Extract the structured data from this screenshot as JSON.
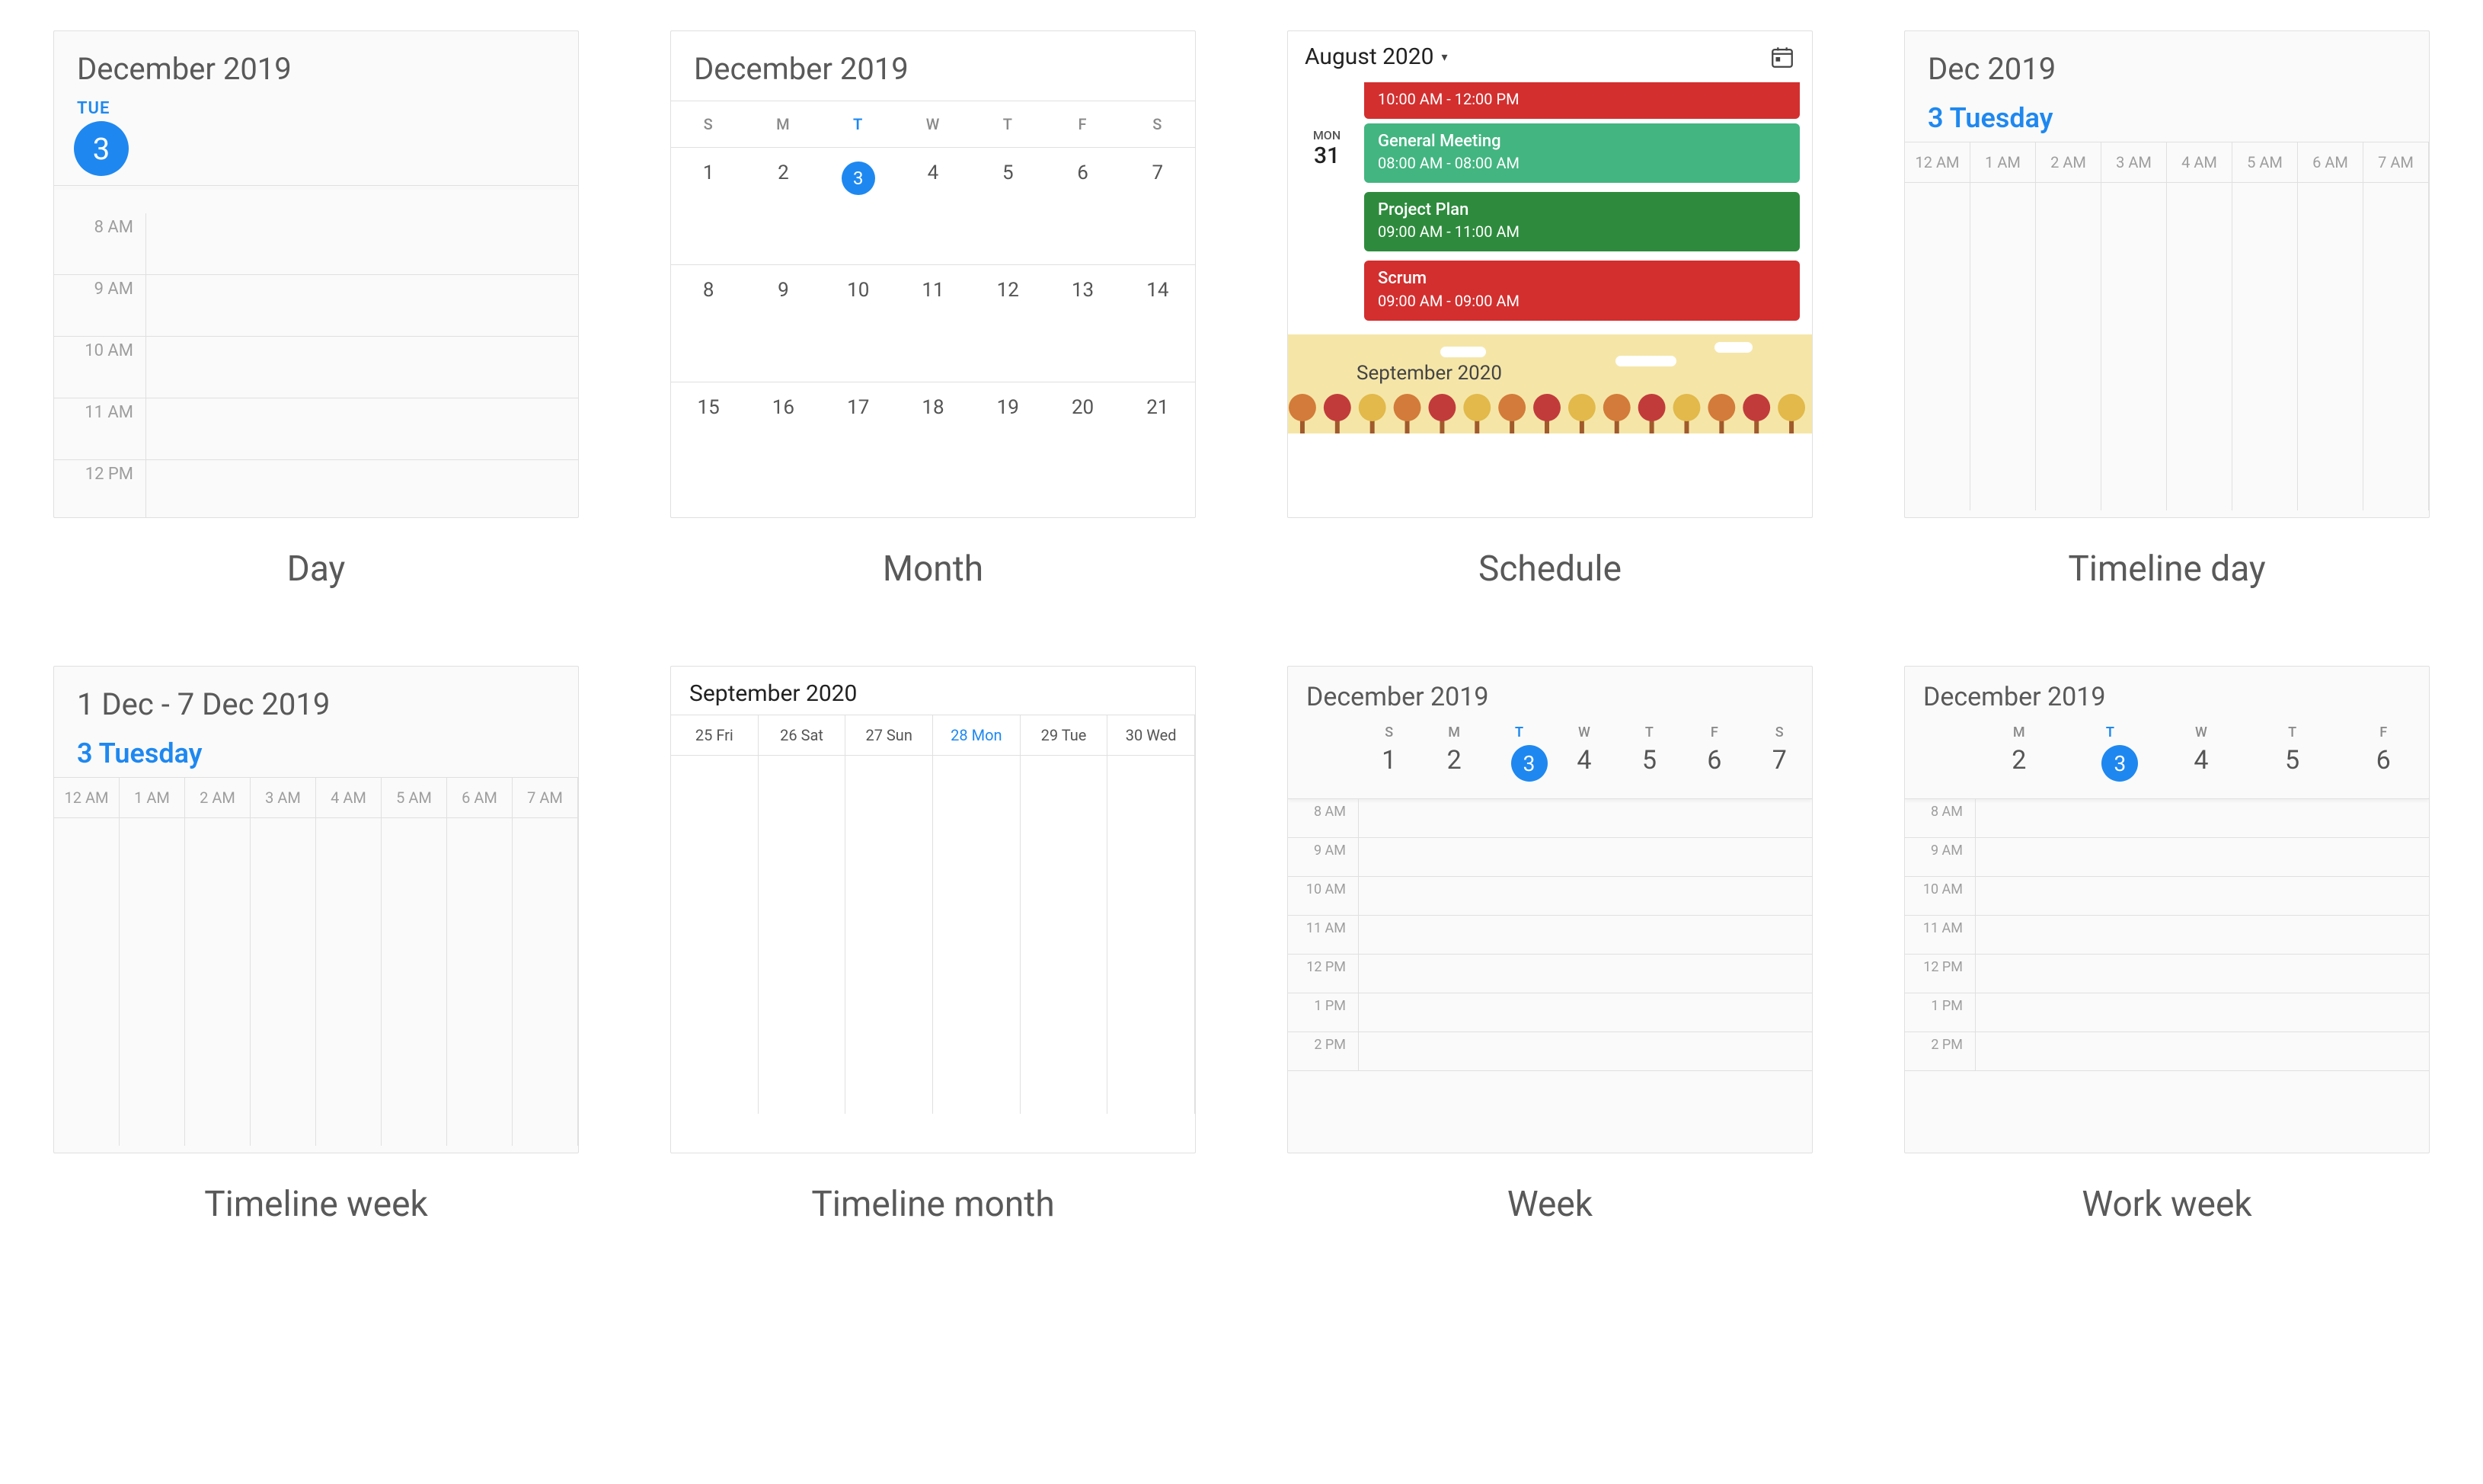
{
  "captions": {
    "day": "Day",
    "month": "Month",
    "schedule": "Schedule",
    "timeline_day": "Timeline day",
    "timeline_week": "Timeline week",
    "timeline_month": "Timeline month",
    "week": "Week",
    "work_week": "Work week"
  },
  "day_view": {
    "title": "December 2019",
    "dow": "TUE",
    "date": "3",
    "hours": [
      "8 AM",
      "9 AM",
      "10 AM",
      "11 AM",
      "12 PM"
    ]
  },
  "month_view": {
    "title": "December 2019",
    "dow": [
      "S",
      "M",
      "T",
      "W",
      "T",
      "F",
      "S"
    ],
    "today_index": 2,
    "weeks": [
      [
        "1",
        "2",
        "3",
        "4",
        "5",
        "6",
        "7"
      ],
      [
        "8",
        "9",
        "10",
        "11",
        "12",
        "13",
        "14"
      ],
      [
        "15",
        "16",
        "17",
        "18",
        "19",
        "20",
        "21"
      ]
    ],
    "today": "3"
  },
  "schedule_view": {
    "title": "August 2020",
    "top_event_time": "10:00 AM - 12:00 PM",
    "day": {
      "dow": "MON",
      "num": "31"
    },
    "events": [
      {
        "title": "General Meeting",
        "time": "08:00 AM - 08:00 AM",
        "color": "g1"
      },
      {
        "title": "Project Plan",
        "time": "09:00 AM - 11:00 AM",
        "color": "g2"
      },
      {
        "title": "Scrum",
        "time": "09:00 AM - 09:00 AM",
        "color": "red"
      }
    ],
    "next_month": "September 2020"
  },
  "timeline_day": {
    "title": "Dec 2019",
    "subtitle": "3 Tuesday",
    "hours": [
      "12 AM",
      "1 AM",
      "2 AM",
      "3 AM",
      "4 AM",
      "5 AM",
      "6 AM",
      "7 AM"
    ]
  },
  "timeline_week": {
    "title": "1 Dec - 7 Dec 2019",
    "subtitle": "3 Tuesday",
    "hours": [
      "12 AM",
      "1 AM",
      "2 AM",
      "3 AM",
      "4 AM",
      "5 AM",
      "6 AM",
      "7 AM"
    ]
  },
  "timeline_month": {
    "title": "September 2020",
    "days": [
      "25 Fri",
      "26 Sat",
      "27 Sun",
      "28 Mon",
      "29 Tue",
      "30 Wed"
    ],
    "today_index": 3
  },
  "week_view": {
    "title": "December 2019",
    "days": [
      {
        "dow": "S",
        "num": "1"
      },
      {
        "dow": "M",
        "num": "2"
      },
      {
        "dow": "T",
        "num": "3",
        "today": true
      },
      {
        "dow": "W",
        "num": "4"
      },
      {
        "dow": "T",
        "num": "5"
      },
      {
        "dow": "F",
        "num": "6"
      },
      {
        "dow": "S",
        "num": "7"
      }
    ],
    "hours": [
      "8 AM",
      "9 AM",
      "10 AM",
      "11 AM",
      "12 PM",
      "1 PM",
      "2 PM"
    ]
  },
  "work_week_view": {
    "title": "December 2019",
    "days": [
      {
        "dow": "M",
        "num": "2"
      },
      {
        "dow": "T",
        "num": "3",
        "today": true
      },
      {
        "dow": "W",
        "num": "4"
      },
      {
        "dow": "T",
        "num": "5"
      },
      {
        "dow": "F",
        "num": "6"
      }
    ],
    "hours": [
      "8 AM",
      "9 AM",
      "10 AM",
      "11 AM",
      "12 PM",
      "1 PM",
      "2 PM"
    ]
  }
}
